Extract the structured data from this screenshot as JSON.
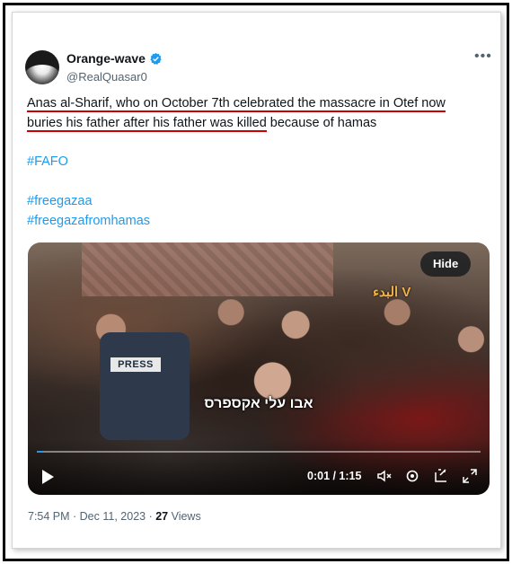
{
  "author": {
    "display_name": "Orange-wave",
    "handle": "@RealQuasar0",
    "verified_icon": "verified-badge-icon",
    "avatar_icon": "avatar"
  },
  "tweet": {
    "text_part1": "Anas al-Sharif, who on October 7th celebrated the massacre in Otef now",
    "text_part2": "buries his father after his father was killed",
    "text_part3": " because of hamas",
    "hashtags": [
      "#FAFO",
      "#freegazaa",
      "#freegazafromhamas"
    ]
  },
  "video": {
    "hide_label": "Hide",
    "caption": "אבו עלי אקספרס",
    "press_label": "PRESS",
    "channel_logo": "البدء V",
    "time": "0:01 / 1:15",
    "progress": 0.013
  },
  "meta": {
    "timestamp": "7:54 PM · Dec 11, 2023 · ",
    "views_count": "27",
    "views_label": " Views"
  },
  "colors": {
    "link": "#1d9bf0",
    "underline": "#cc0000",
    "verified": "#1d9bf0"
  }
}
